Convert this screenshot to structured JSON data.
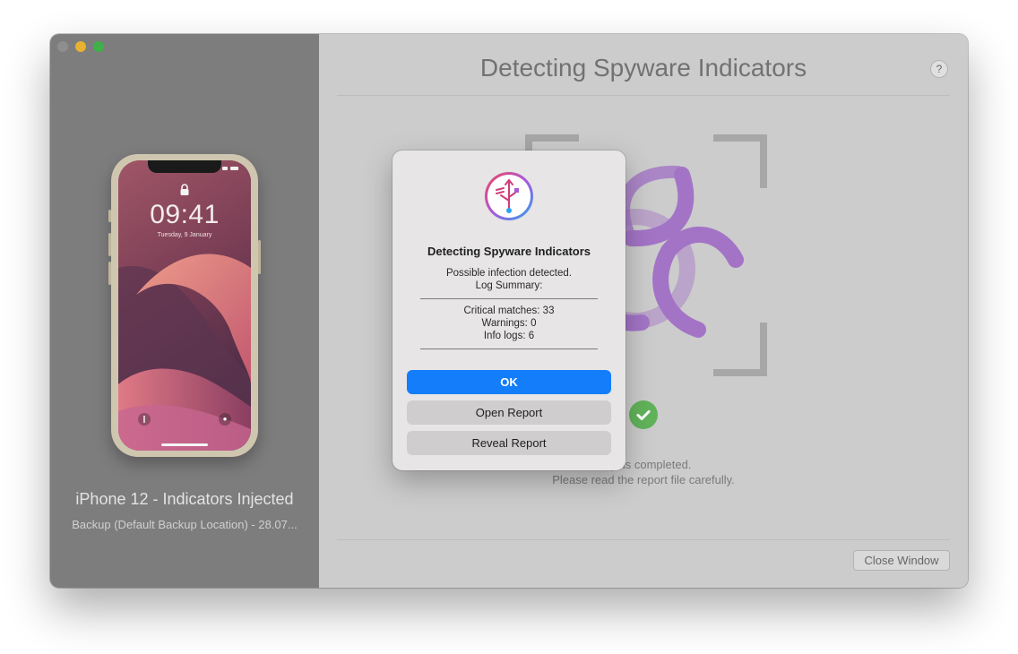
{
  "window": {
    "title": "Detecting Spyware Indicators",
    "help_label": "?",
    "close_window_label": "Close Window"
  },
  "sidebar": {
    "device_name": "iPhone 12 - Indicators Injected",
    "device_subtitle": "Backup (Default Backup Location) - 28.07..."
  },
  "phone_screen": {
    "time": "09:41",
    "date": "Tuesday, 9 January"
  },
  "main": {
    "status_line_1": "nalysis completed.",
    "status_line_2": "Please read the report file carefully."
  },
  "alert": {
    "title": "Detecting Spyware Indicators",
    "message_line_1": "Possible infection detected.",
    "message_line_2": "Log Summary:",
    "critical_matches": "Critical matches: 33",
    "warnings": "Warnings: 0",
    "info_logs": "Info logs: 6",
    "ok_label": "OK",
    "open_report_label": "Open Report",
    "reveal_report_label": "Reveal Report"
  },
  "colors": {
    "accent": "#147dfa",
    "hazard_purple": "#a374c6",
    "success_green": "#61b35a"
  }
}
